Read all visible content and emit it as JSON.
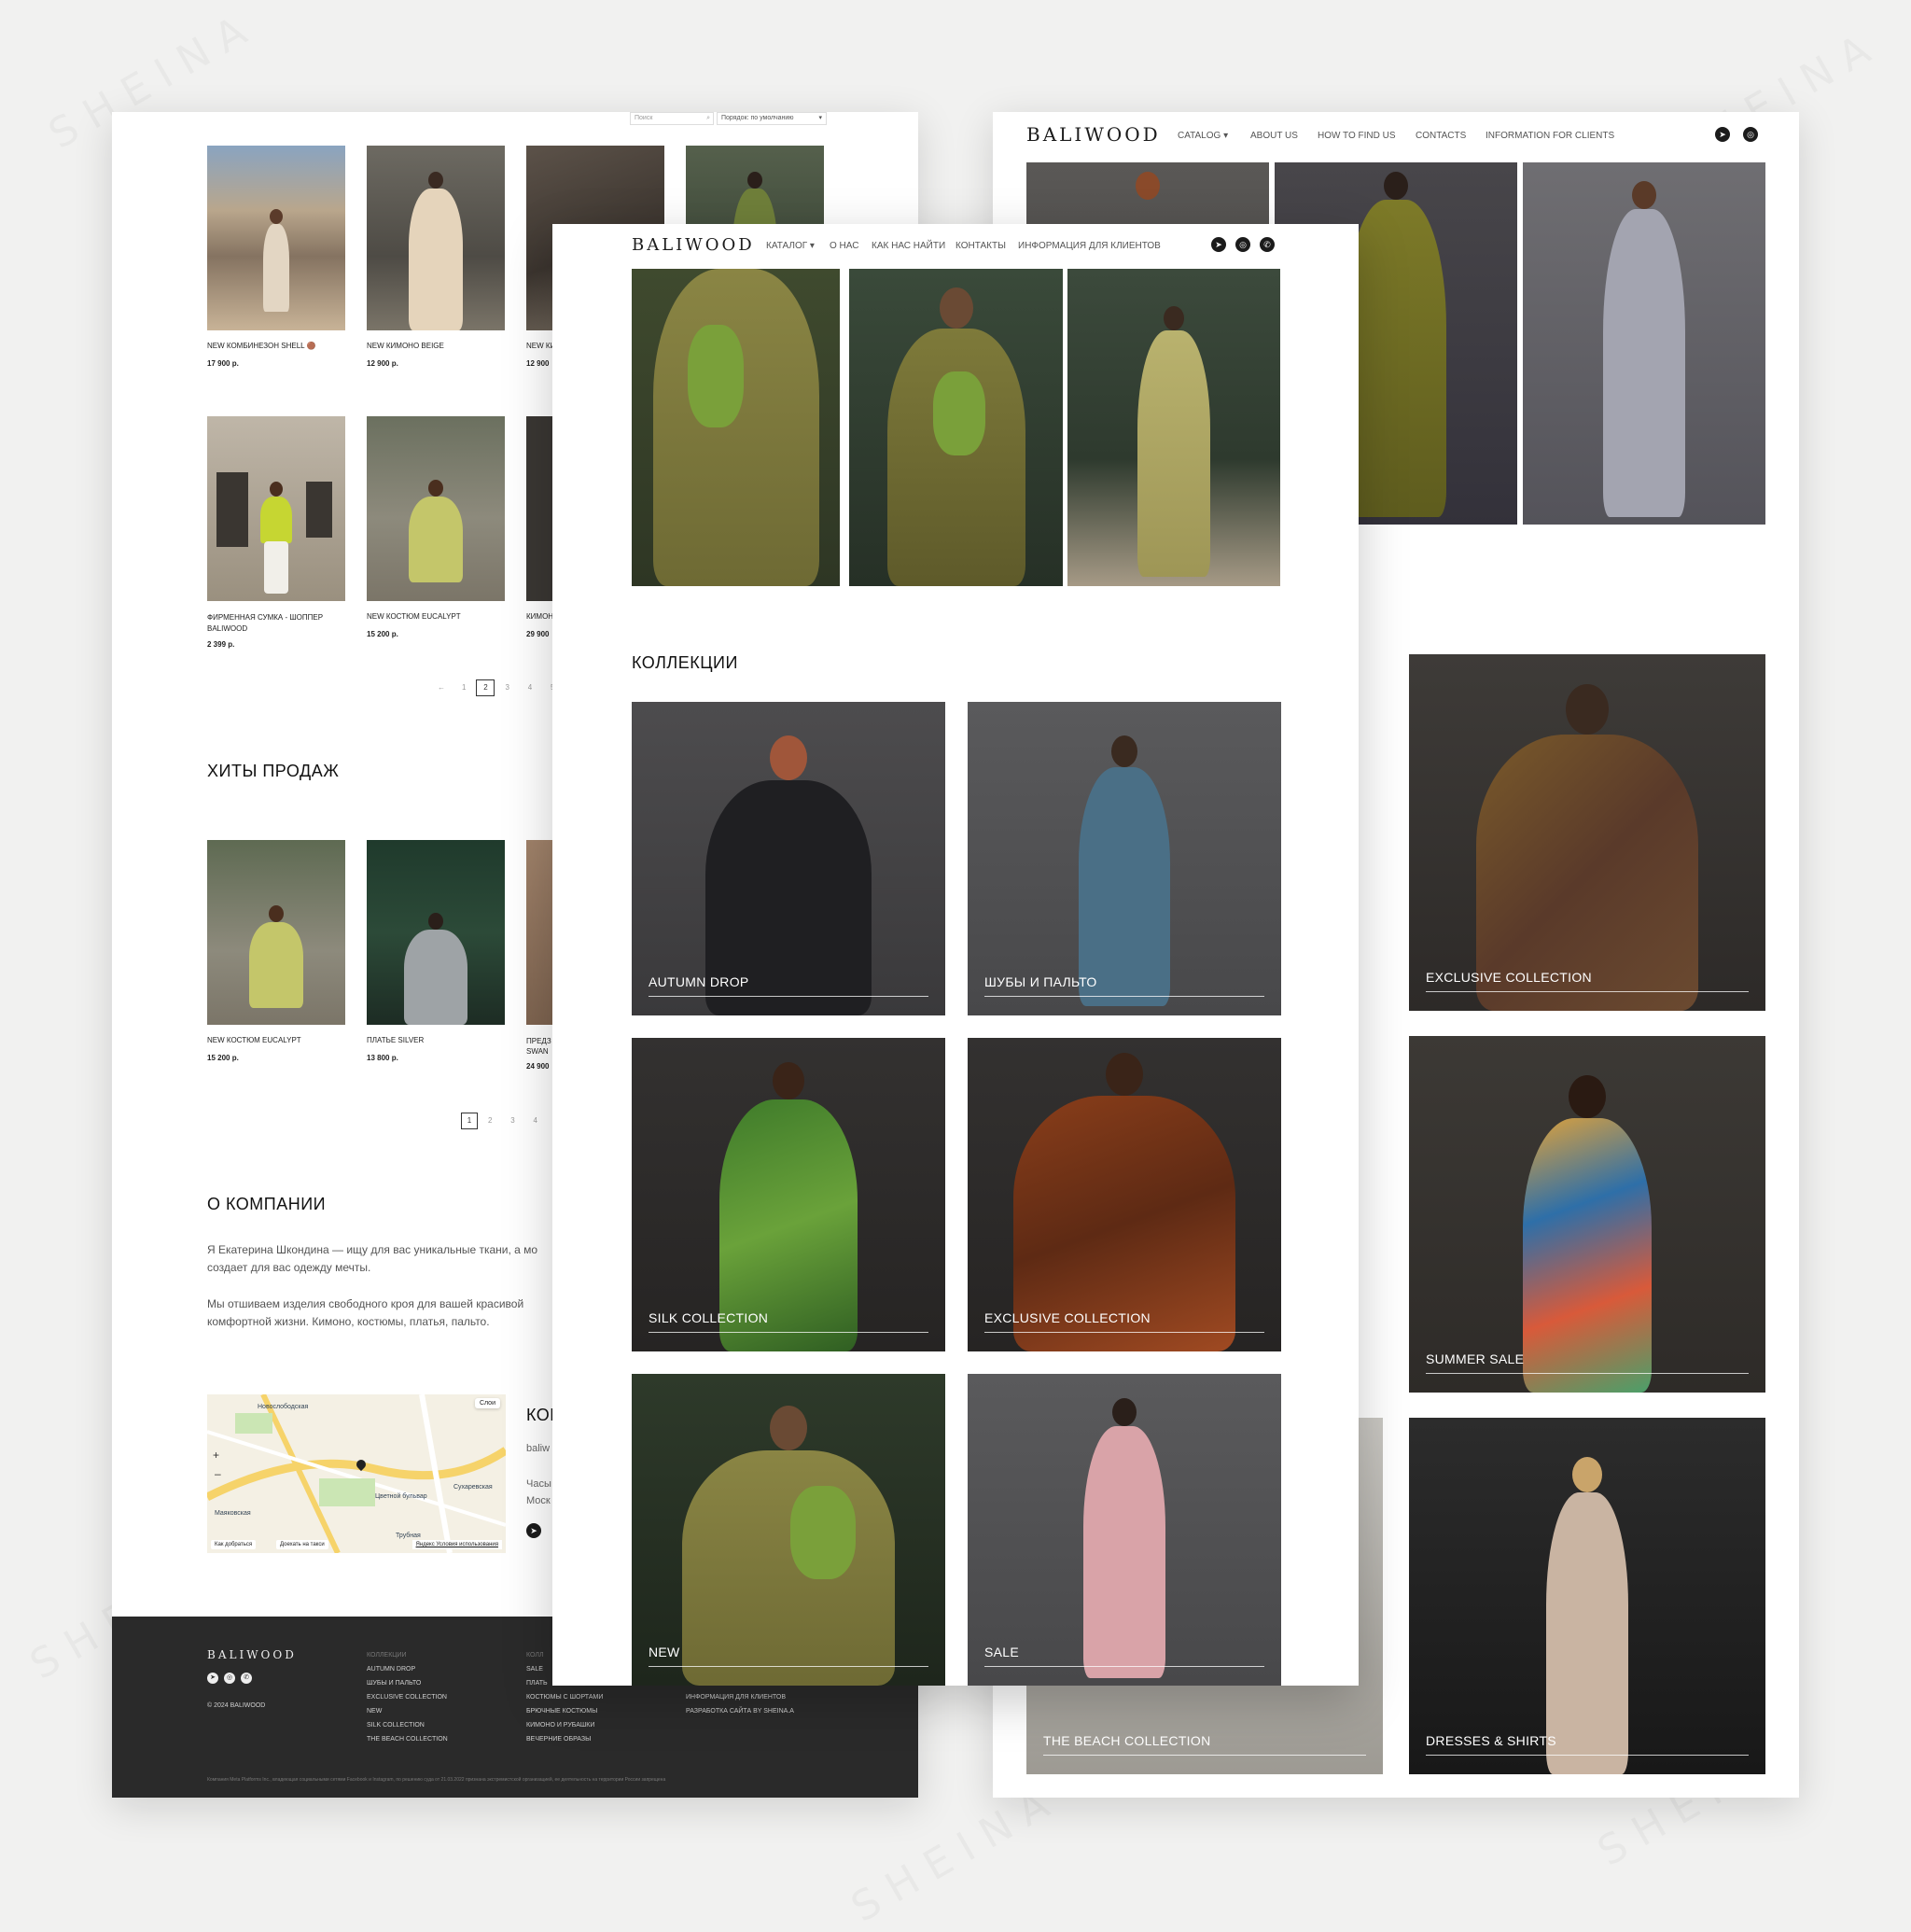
{
  "brand": "BALIWOOD",
  "watermark": "SHEINA",
  "left_page": {
    "search_placeholder": "Поиск",
    "sort_label": "Порядок: по умолчанию",
    "products_row1": [
      {
        "name": "NEW КОМБИНЕЗОН SHELL 🟤",
        "price": "17 900 р."
      },
      {
        "name": "NEW КИМОНО BEIGE",
        "price": "12 900 р."
      },
      {
        "name": "NEW КИ",
        "price": "12 900"
      },
      {
        "name": "",
        "price": ""
      }
    ],
    "products_row2": [
      {
        "name": "ФИРМЕННАЯ СУМКА - ШОППЕР BALIWOOD",
        "price": "2 399 р."
      },
      {
        "name": "NEW КОСТЮМ EUCALYPT",
        "price": "15 200 р."
      },
      {
        "name": "КИМОН",
        "price": "29 900"
      }
    ],
    "pagination1": [
      "←",
      "1",
      "2",
      "3",
      "4",
      "5"
    ],
    "hits_title": "ХИТЫ ПРОДАЖ",
    "hits": [
      {
        "name": "NEW КОСТЮМ EUCALYPT",
        "price": "15 200 р."
      },
      {
        "name": "ПЛАТЬЕ SILVER",
        "price": "13 800 р."
      },
      {
        "name": "ПРЕДЗ SWAN",
        "price": "24 900"
      }
    ],
    "pagination2": [
      "1",
      "2",
      "3",
      "4"
    ],
    "about_title": "О КОМПАНИИ",
    "about_p1": "Я Екатерина Шкондина — ищу для вас уникальные ткани, а мо создает для вас одежду мечты.",
    "about_p2": "Мы отшиваем изделия свободного кроя для вашей красивой комфортной жизни. Кимоно, костюмы, платья, пальто.",
    "map_labels": {
      "layers": "Слои",
      "route": "Как добраться",
      "taxi": "Доехать на такси",
      "terms": "Яндекс Условия использования",
      "district1": "Новослободская",
      "district2": "Сухаревская",
      "district3": "Цветной бульвар",
      "district4": "Маяковская",
      "district5": "Трубная"
    },
    "contacts_title": "КОН",
    "contacts_lines": [
      "baliw",
      "Часы",
      "Моск"
    ]
  },
  "footer": {
    "copyright": "© 2024 BALIWOOD",
    "col1_title": "КОЛЛЕКЦИИ",
    "col1": [
      "AUTUMN DROP",
      "ШУБЫ И ПАЛЬТО",
      "EXCLUSIVE COLLECTION",
      "NEW",
      "SILK COLLECTION",
      "THE BEACH COLLECTION"
    ],
    "col2_title": "КОЛЛ",
    "col2": [
      "SALE",
      "ПЛАТЬ",
      "КОСТЮМЫ С ШОРТАМИ",
      "БРЮЧНЫЕ КОСТЮМЫ",
      "КИМОНО И РУБАШКИ",
      "ВЕЧЕРНИЕ ОБРАЗЫ"
    ],
    "col3": [
      "ИНФОРМАЦИЯ ДЛЯ КЛИЕНТОВ",
      "РАЗРАБОТКА САЙТА BY SHEINA.A"
    ],
    "disclaimer": "Компания Meta Platforms Inc., владеющая социальными сетями Facebook и Instagram, по решению суда от 21.03.2022 признана экстремистской организацией, ее деятельность на территории России запрещена"
  },
  "right_page": {
    "nav": [
      "CATALOG ▾",
      "ABOUT US",
      "HOW TO FIND US",
      "CONTACTS",
      "INFORMATION FOR CLIENTS"
    ],
    "tiles": [
      "EXCLUSIVE COLLECTION",
      "SUMMER SALE",
      "THE BEACH COLLECTION",
      "DRESSES & SHIRTS"
    ]
  },
  "center_page": {
    "nav": [
      "КАТАЛОГ ▾",
      "О НАС",
      "КАК НАС НАЙТИ",
      "КОНТАКТЫ",
      "ИНФОРМАЦИЯ ДЛЯ КЛИЕНТОВ"
    ],
    "collections_title": "КОЛЛЕКЦИИ",
    "tiles": [
      "AUTUMN DROP",
      "ШУБЫ И ПАЛЬТО",
      "SILK COLLECTION",
      "EXCLUSIVE COLLECTION",
      "NEW",
      "SALE"
    ]
  },
  "icons": [
    "telegram-icon",
    "instagram-icon",
    "whatsapp-icon",
    "search-icon",
    "chevron-down-icon",
    "map-pin-icon"
  ]
}
